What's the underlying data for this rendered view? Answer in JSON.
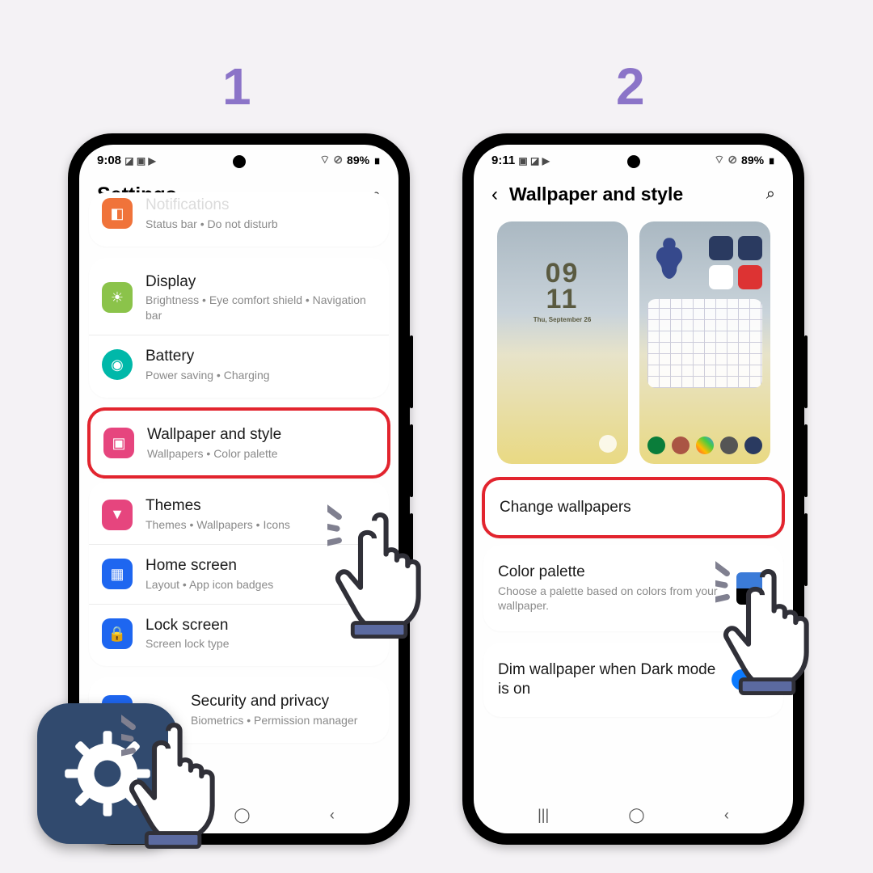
{
  "steps": {
    "one": "1",
    "two": "2"
  },
  "phone1": {
    "status": {
      "time": "9:08",
      "icons": "◪ ▣ ▶",
      "battery": "89%",
      "batt_icons": "⌔ ⊘"
    },
    "title": "Settings",
    "rows": {
      "notifications": {
        "label": "Notifications",
        "sub": "Status bar  •  Do not disturb"
      },
      "display": {
        "label": "Display",
        "sub": "Brightness  •  Eye comfort shield  •  Navigation bar"
      },
      "battery": {
        "label": "Battery",
        "sub": "Power saving  •  Charging"
      },
      "wallpaper": {
        "label": "Wallpaper and style",
        "sub": "Wallpapers  •  Color palette"
      },
      "themes": {
        "label": "Themes",
        "sub": "Themes  •  Wallpapers  •  Icons"
      },
      "home": {
        "label": "Home screen",
        "sub": "Layout  •  App icon badges"
      },
      "lock": {
        "label": "Lock screen",
        "sub": "Screen lock type"
      },
      "security": {
        "label": "Security and privacy",
        "sub": "Biometrics  •  Permission manager"
      }
    }
  },
  "phone2": {
    "status": {
      "time": "9:11",
      "icons": "▣ ◪ ▶",
      "battery": "89%",
      "batt_icons": "⌔ ⊘"
    },
    "title": "Wallpaper and style",
    "preview_clock": {
      "time_top": "09",
      "time_bot": "11",
      "date": "Thu, September 26"
    },
    "rows": {
      "change": {
        "label": "Change wallpapers"
      },
      "palette": {
        "label": "Color palette",
        "sub": "Choose a palette based on colors from your wallpaper."
      },
      "dim": {
        "label": "Dim wallpaper when Dark mode is on"
      }
    }
  },
  "ui": {
    "search_glyph": "⌕",
    "back_glyph": "‹",
    "nav": {
      "recent": "|||",
      "home": "◯",
      "back": "‹"
    }
  }
}
